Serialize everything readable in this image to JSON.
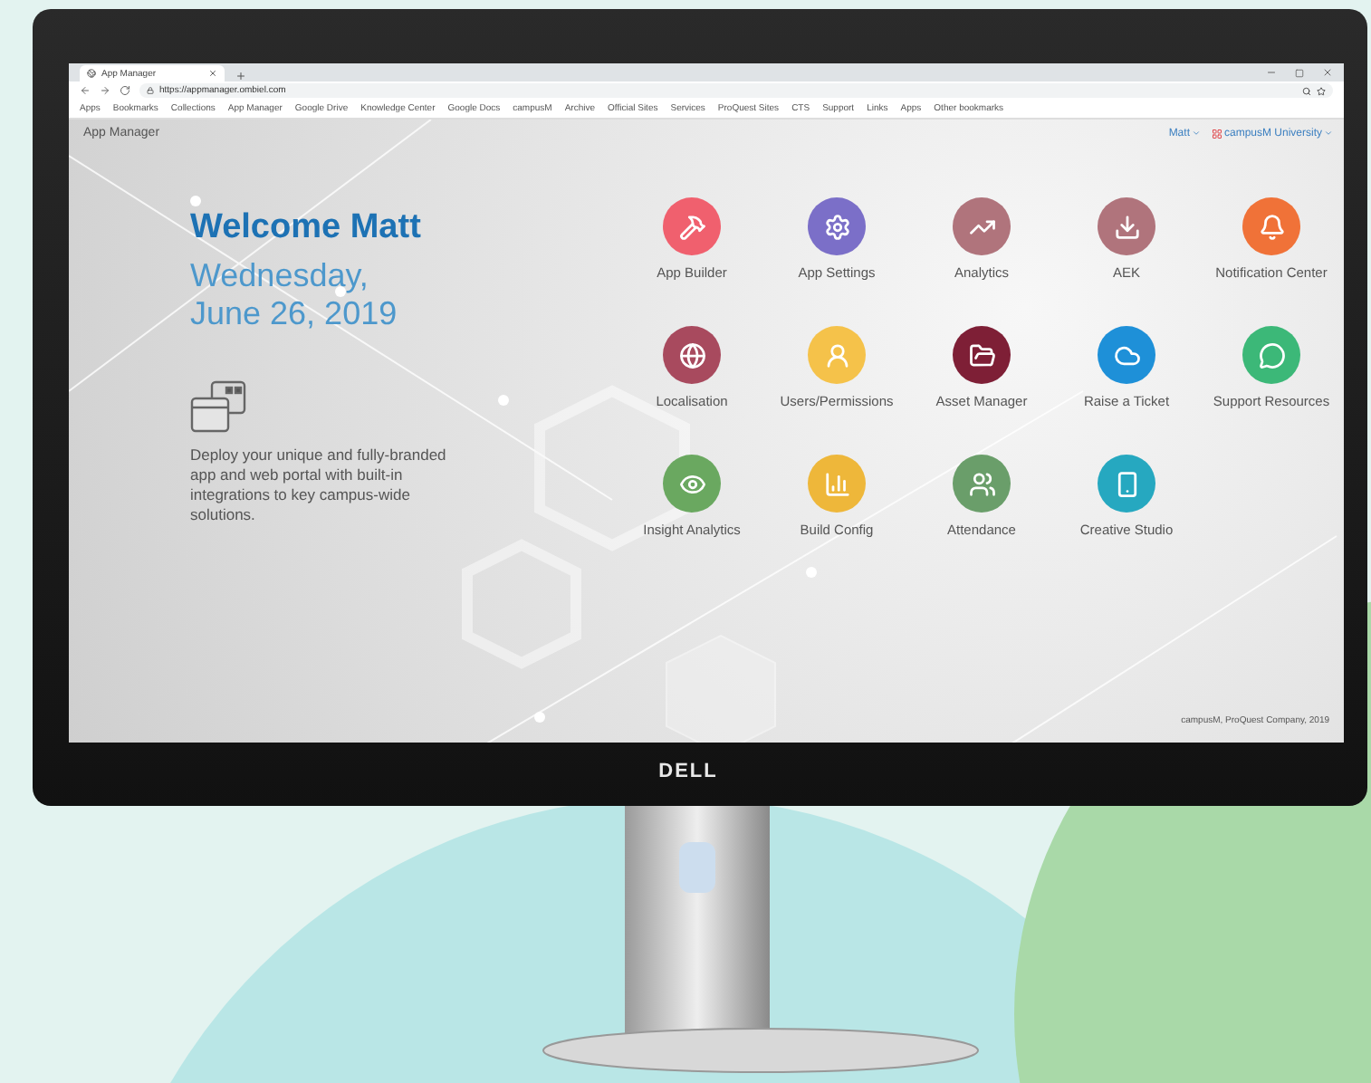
{
  "browser": {
    "tab_title": "App Manager",
    "url": "https://appmanager.ombiel.com",
    "bookmarks": [
      "Apps",
      "Bookmarks",
      "Collections",
      "App Manager",
      "Google Drive",
      "Knowledge Center",
      "Google Docs",
      "campusM",
      "Archive",
      "Official Sites",
      "Services",
      "ProQuest Sites",
      "CTS",
      "Support",
      "Links",
      "Apps",
      "Other bookmarks"
    ]
  },
  "app": {
    "title": "App Manager",
    "user": "Matt",
    "institution": "campusM University",
    "welcome": "Welcome Matt",
    "date_line_1": "Wednesday,",
    "date_line_2": "June 26, 2019",
    "description": "Deploy your unique and fully-branded app and web portal with built-in integrations to key campus-wide solutions.",
    "tiles": [
      {
        "label": "App Builder",
        "color": "#f0606e",
        "kind": "tools"
      },
      {
        "label": "App Settings",
        "color": "#7b6fc8",
        "kind": "gear"
      },
      {
        "label": "Analytics",
        "color": "#b0747c",
        "kind": "chart"
      },
      {
        "label": "AEK",
        "color": "#b0747c",
        "kind": "download"
      },
      {
        "label": "Notification Center",
        "color": "#f07238",
        "kind": "bell"
      },
      {
        "label": "Localisation",
        "color": "#a84a5e",
        "kind": "globe"
      },
      {
        "label": "Users/Permissions",
        "color": "#f5c24a",
        "kind": "user"
      },
      {
        "label": "Asset Manager",
        "color": "#7e1f36",
        "kind": "folder"
      },
      {
        "label": "Raise a Ticket",
        "color": "#1e90d8",
        "kind": "cloud"
      },
      {
        "label": "Support Resources",
        "color": "#3cb878",
        "kind": "chat"
      },
      {
        "label": "Insight Analytics",
        "color": "#6aa860",
        "kind": "eye"
      },
      {
        "label": "Build Config",
        "color": "#eeb73a",
        "kind": "bars"
      },
      {
        "label": "Attendance",
        "color": "#6a9e6a",
        "kind": "users"
      },
      {
        "label": "Creative Studio",
        "color": "#26a8c0",
        "kind": "phone"
      }
    ],
    "footer": "campusM, ProQuest Company, 2019"
  },
  "monitor": {
    "logo": "DELL"
  }
}
